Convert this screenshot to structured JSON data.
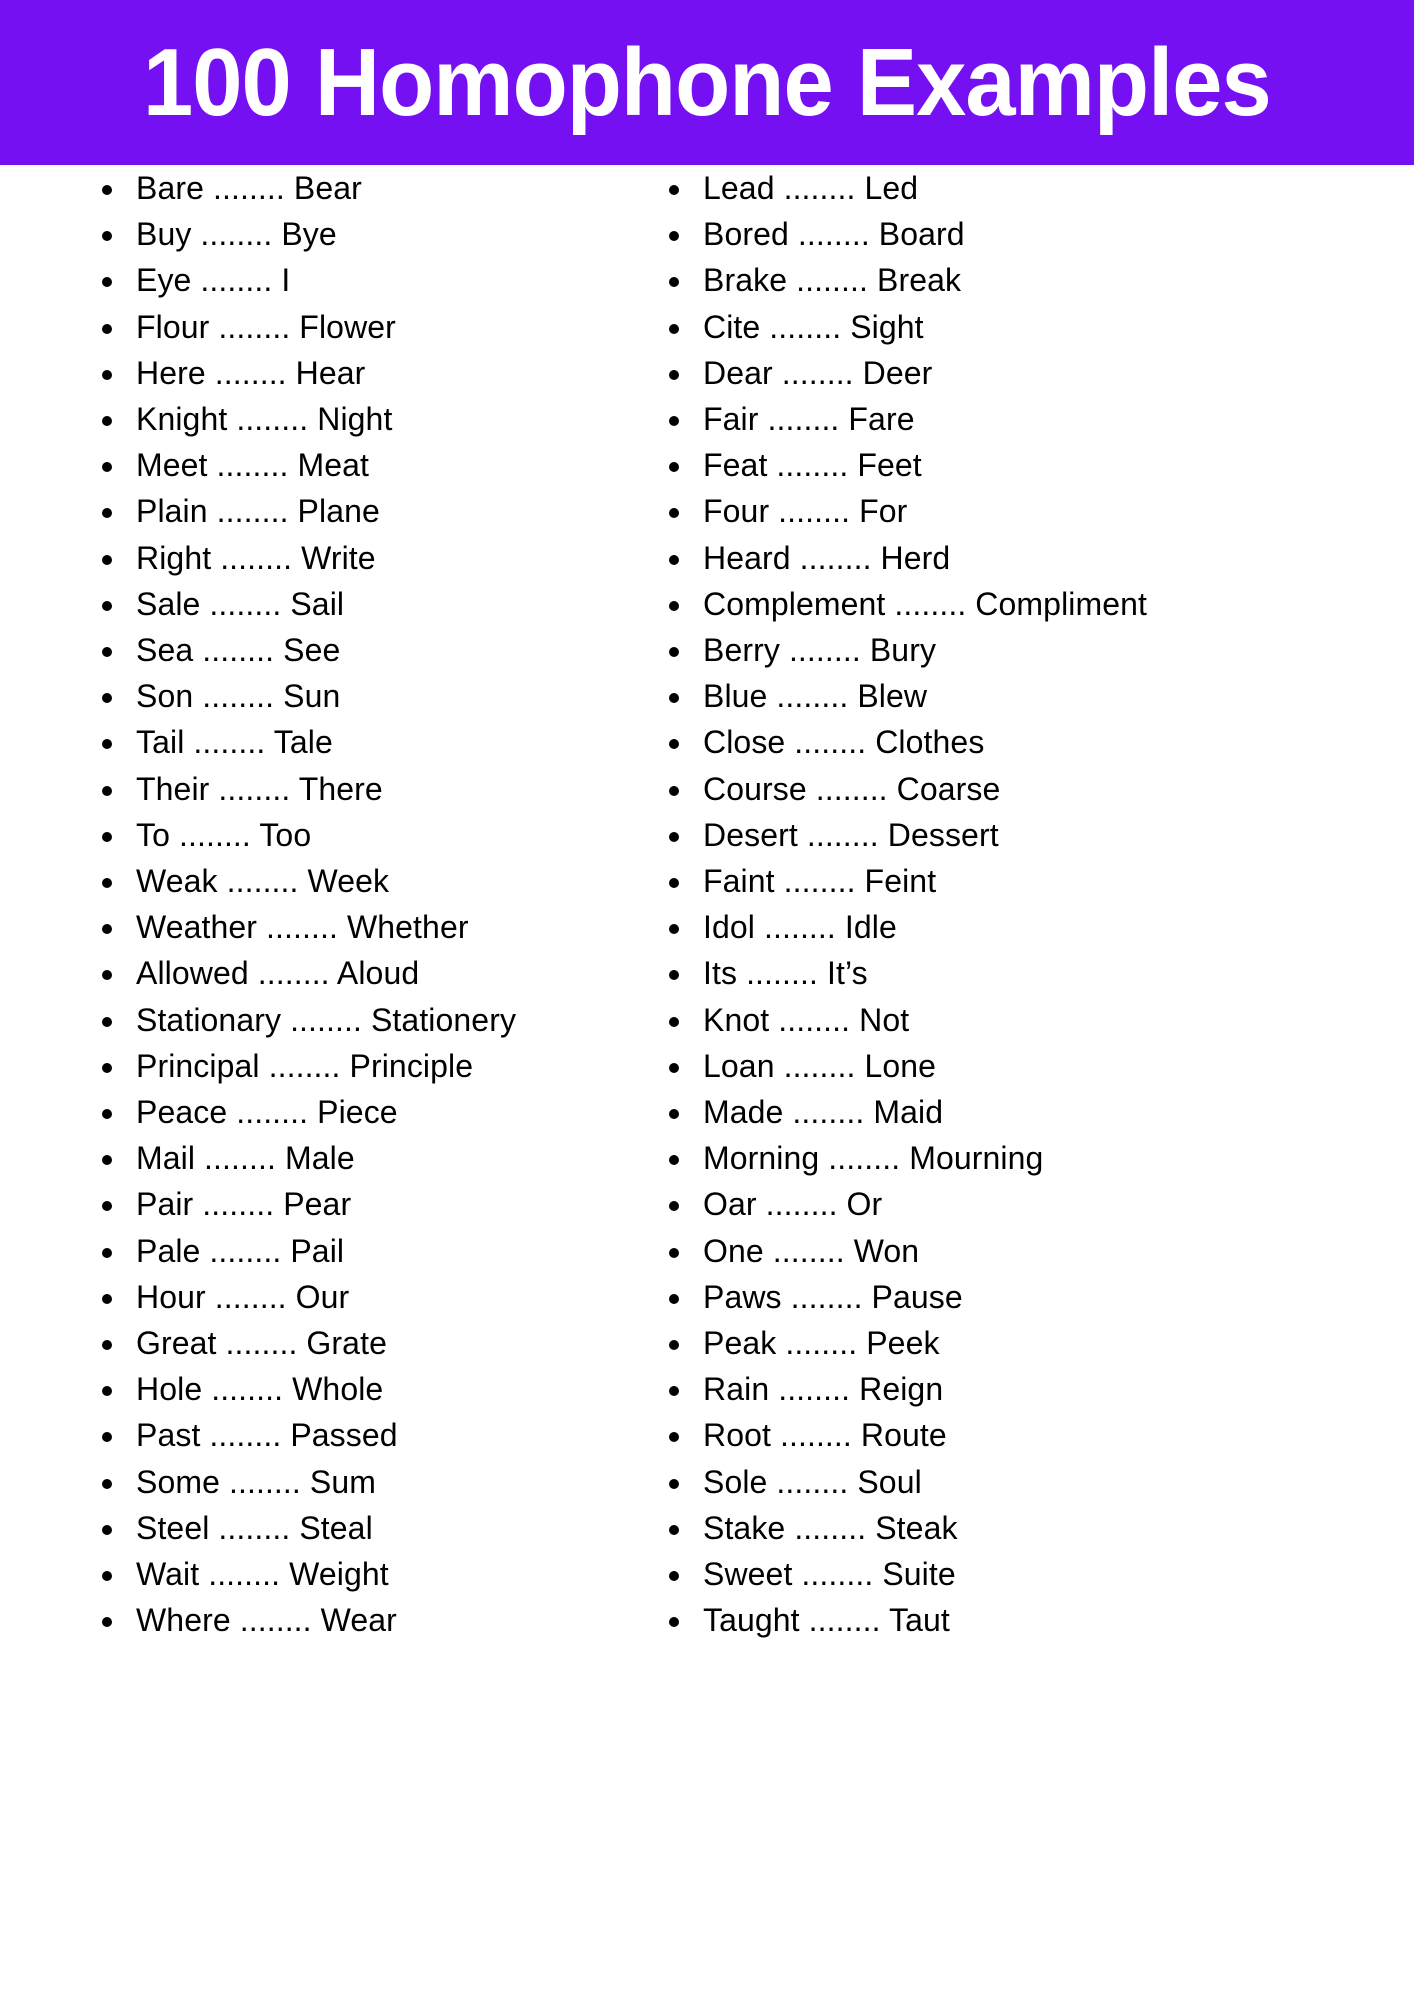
{
  "header": {
    "title": "100 Homophone Examples",
    "background_color": "#7410F2",
    "text_color": "#FFFFFF"
  },
  "page": {
    "background_color": "#FFFFFF",
    "text_color": "#000000",
    "separator": "........"
  },
  "columns": {
    "left": {
      "items": [
        "Bare ........ Bear",
        "Buy ........ Bye",
        "Eye ........ I",
        "Flour ........ Flower",
        "Here ........ Hear",
        "Knight ........ Night",
        "Meet ........ Meat",
        "Plain ........ Plane",
        "Right ........ Write",
        "Sale ........ Sail",
        "Sea ........ See",
        "Son ........ Sun",
        "Tail ........ Tale",
        "Their ........ There",
        "To ........ Too",
        "Weak ........ Week",
        "Weather ........ Whether",
        "Allowed ........ Aloud",
        "Stationary ........ Stationery",
        "Principal ........ Principle",
        "Peace ........ Piece",
        "Mail ........ Male",
        "Pair ........ Pear",
        "Pale ........ Pail",
        "Hour ........ Our",
        "Great ........ Grate",
        "Hole ........ Whole",
        "Past ........ Passed",
        "Some ........ Sum",
        "Steel ........ Steal",
        "Wait ........ Weight",
        "Where ........ Wear"
      ]
    },
    "right": {
      "items": [
        "Lead ........ Led",
        "Bored ........ Board",
        "Brake ........ Break",
        "Cite ........ Sight",
        "Dear ........ Deer",
        "Fair ........ Fare",
        "Feat ........ Feet",
        "Four ........ For",
        "Heard ........ Herd",
        "Complement ........ Compliment",
        "Berry ........ Bury",
        "Blue ........ Blew",
        "Close ........ Clothes",
        "Course ........ Coarse",
        "Desert ........ Dessert",
        "Faint ........ Feint",
        "Idol ........ Idle",
        "Its ........ It’s",
        "Knot ........ Not",
        "Loan ........ Lone",
        "Made ........ Maid",
        "Morning ........ Mourning",
        "Oar ........ Or",
        "One ........ Won",
        "Paws ........ Pause",
        "Peak ........ Peek",
        "Rain ........ Reign",
        "Root ........ Route",
        "Sole ........ Soul",
        "Stake ........ Steak",
        "Sweet ........ Suite",
        "Taught ........ Taut"
      ]
    }
  }
}
